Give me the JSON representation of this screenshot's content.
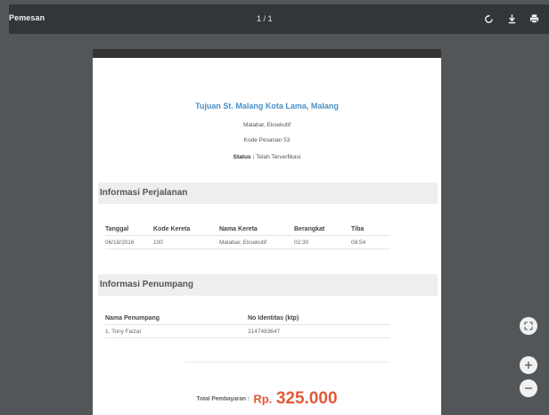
{
  "toolbar": {
    "title": "Pemesan",
    "page_indicator": "1 / 1"
  },
  "document": {
    "destination": "Tujuan St. Malang Kota Lama, Malang",
    "train": "Malabar, Eksekutif",
    "booking_code": "Kode Pesanan 53",
    "status_label": "Status :",
    "status_value": "Telah Terverfikasi",
    "trip_section": {
      "title": "Informasi Perjalanan",
      "headers": [
        "Tanggal",
        "Kode Kereta",
        "Nama Kereta",
        "Berangkat",
        "Tiba"
      ],
      "rows": [
        [
          "06/18/2016",
          "100",
          "Malabar, Eksekutif",
          "02:30",
          "08:54"
        ]
      ]
    },
    "passenger_section": {
      "title": "Informasi Penumpang",
      "headers": [
        "Nama Penumpang",
        "No Identitas (ktp)"
      ],
      "rows": [
        [
          "1. Tony Faizal",
          "2147483647"
        ]
      ]
    },
    "total": {
      "label": "Total Pembayaran :",
      "currency": "Rp.",
      "amount": "325.000"
    }
  },
  "colors": {
    "toolbar_bg": "#323639",
    "viewer_bg": "#525659",
    "accent_blue": "#4a90c7",
    "total_red": "#e05a3a"
  }
}
